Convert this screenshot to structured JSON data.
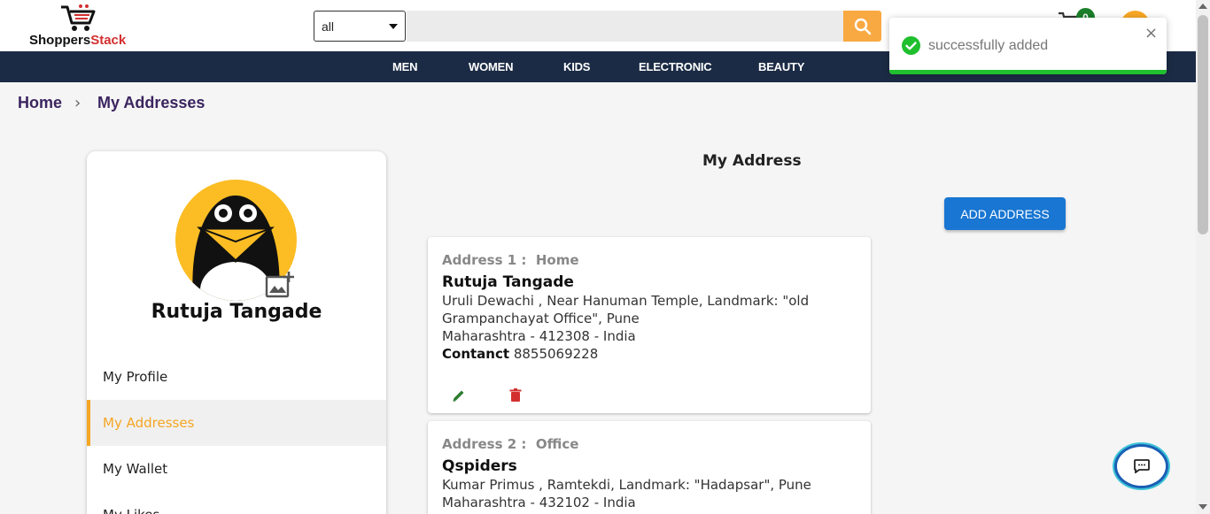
{
  "header": {
    "logo": {
      "part1": "Shoppers",
      "part2": "Stack",
      "accent": "#d32f2f"
    },
    "search": {
      "category_selected": "all",
      "placeholder": "",
      "button_icon": "search-icon",
      "button_color": "#f9a942"
    },
    "cart": {
      "count": "0",
      "icon": "cart-icon",
      "badge_color": "#1b7f2a"
    },
    "account": {
      "icon": "avatar-icon",
      "color": "#f9a825"
    }
  },
  "nav": {
    "items": [
      {
        "label": "MEN"
      },
      {
        "label": "WOMEN"
      },
      {
        "label": "KIDS"
      },
      {
        "label": "ELECTRONIC"
      },
      {
        "label": "BEAUTY"
      }
    ],
    "background": "#1c2b45"
  },
  "breadcrumb": {
    "home": "Home",
    "separator": "›",
    "current": "My Addresses"
  },
  "profile": {
    "name": "Rutuja Tangade",
    "menu": [
      {
        "label": "My Profile",
        "active": false
      },
      {
        "label": "My Addresses",
        "active": true
      },
      {
        "label": "My Wallet",
        "active": false
      },
      {
        "label": "My Likes",
        "active": false
      }
    ],
    "accent": "#f5a623"
  },
  "main": {
    "title": "My Address",
    "add_button": "ADD ADDRESS",
    "addresses": [
      {
        "label": "Address 1 :",
        "type": "Home",
        "name": "Rutuja Tangade",
        "line1": "Uruli Dewachi , Near Hanuman Temple, Landmark: \"old Grampanchayat Office\", Pune",
        "line2": "Maharashtra - 412308 - India",
        "contact_label": "Contanct",
        "contact": "8855069228"
      },
      {
        "label": "Address 2 :",
        "type": "Office",
        "name": "Qspiders",
        "line1": "Kumar Primus , Ramtekdi, Landmark: \"Hadapsar\", Pune",
        "line2": "Maharashtra - 432102 - India"
      }
    ]
  },
  "toast": {
    "message": "successfully added",
    "status_color": "#1fbf2e",
    "close": "×"
  }
}
